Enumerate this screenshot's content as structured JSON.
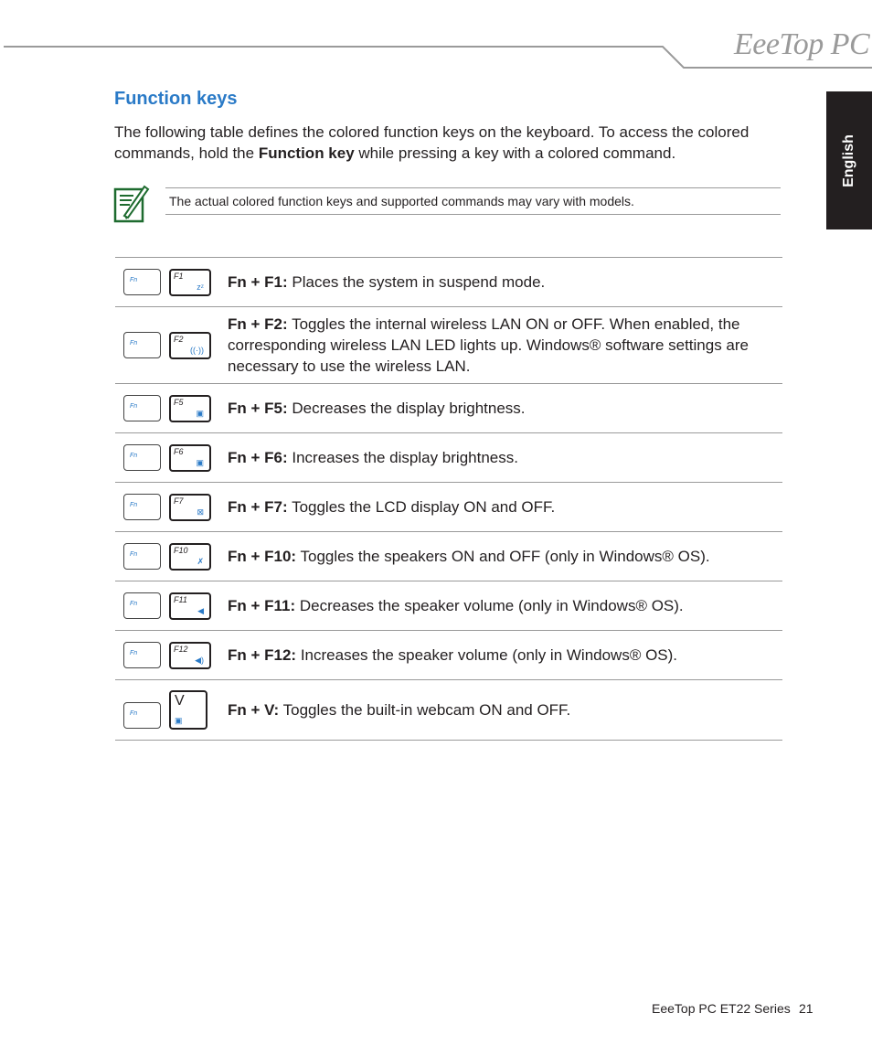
{
  "header": {
    "logo_text": "EeeTop PC",
    "language_tab": "English"
  },
  "section": {
    "title": "Function keys",
    "intro_part1": "The following table defines the colored function keys on the keyboard. To access the colored commands, hold the ",
    "intro_bold": "Function key",
    "intro_part2": " while pressing a key with a colored command."
  },
  "note": {
    "icon": "note-pencil-icon",
    "text": "The actual colored function keys and supported commands may vary with models."
  },
  "function_keys": [
    {
      "fn_label": "Fn",
      "key_label": "F1",
      "icon": "sleep-zz-icon",
      "glyph": "zᶻ",
      "combo": "Fn + F1:",
      "description": " Places the system in suspend mode."
    },
    {
      "fn_label": "Fn",
      "key_label": "F2",
      "icon": "wireless-antenna-icon",
      "glyph": "((·))",
      "combo": "Fn + F2:",
      "description": " Toggles the internal wireless LAN ON or OFF. When enabled, the corresponding wireless LAN LED lights up. Windows® software settings are necessary to use the wireless LAN."
    },
    {
      "fn_label": "Fn",
      "key_label": "F5",
      "icon": "brightness-down-icon",
      "glyph": "▣",
      "combo": "Fn + F5:",
      "description": " Decreases the display brightness."
    },
    {
      "fn_label": "Fn",
      "key_label": "F6",
      "icon": "brightness-up-icon",
      "glyph": "▣",
      "combo": "Fn + F6:",
      "description": " Increases the display brightness."
    },
    {
      "fn_label": "Fn",
      "key_label": "F7",
      "icon": "display-off-icon",
      "glyph": "⊠",
      "combo": "Fn + F7:",
      "description": " Toggles the LCD display ON and OFF."
    },
    {
      "fn_label": "Fn",
      "key_label": "F10",
      "icon": "speaker-mute-icon",
      "glyph": "✗",
      "combo": "Fn + F10:",
      "description": " Toggles the speakers ON and OFF (only in Windows® OS)."
    },
    {
      "fn_label": "Fn",
      "key_label": "F11",
      "icon": "volume-down-icon",
      "glyph": "◀",
      "combo": "Fn + F11:",
      "description": " Decreases the speaker volume (only in Windows® OS)."
    },
    {
      "fn_label": "Fn",
      "key_label": "F12",
      "icon": "volume-up-icon",
      "glyph": "◀)",
      "combo": "Fn + F12:",
      "description": " Increases the speaker volume (only in Windows® OS)."
    },
    {
      "fn_label": "Fn",
      "key_label": "V",
      "icon": "webcam-icon",
      "glyph": "▣",
      "combo": "Fn + V:",
      "description": " Toggles the built-in webcam ON and OFF."
    }
  ],
  "footer": {
    "series": "EeeTop PC ET22 Series",
    "page_number": "21"
  }
}
